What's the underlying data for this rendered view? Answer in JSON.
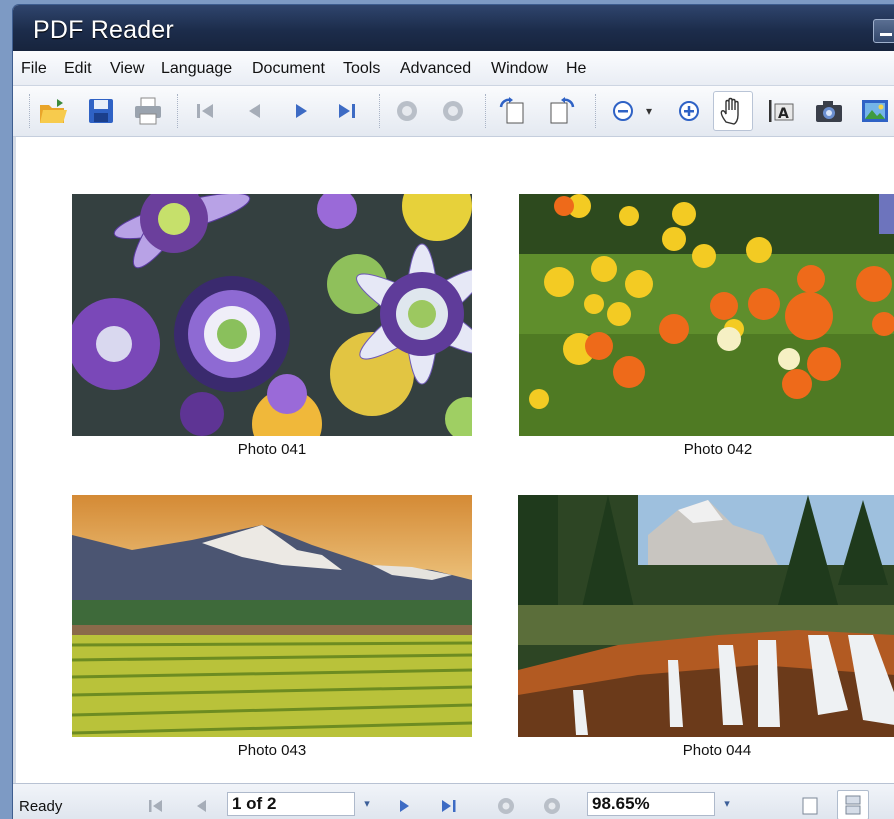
{
  "window": {
    "title": "PDF Reader"
  },
  "menu": [
    "File",
    "Edit",
    "View",
    "Language",
    "Document",
    "Tools",
    "Advanced",
    "Window",
    "He"
  ],
  "toolbar": {
    "zoom_dropdown_glyph": "▾",
    "icons": [
      "open-folder-icon",
      "save-icon",
      "print-icon",
      "first-page-icon",
      "previous-page-icon",
      "next-page-icon",
      "last-page-icon",
      "back-icon",
      "forward-icon",
      "rotate-left-icon",
      "rotate-right-icon",
      "zoom-out-icon",
      "zoom-in-icon",
      "hand-tool-icon",
      "text-select-icon",
      "snapshot-icon",
      "image-icon"
    ]
  },
  "photos": [
    {
      "caption": "Photo 041"
    },
    {
      "caption": "Photo 042"
    },
    {
      "caption": "Photo 043"
    },
    {
      "caption": "Photo 044"
    }
  ],
  "statusbar": {
    "status": "Ready",
    "page_field": "1 of 2",
    "zoom_field": "98.65%",
    "drop_glyph": "▾"
  },
  "colors": {
    "accent": "#2f456d",
    "nav_arrow": "#3d6bc4"
  }
}
